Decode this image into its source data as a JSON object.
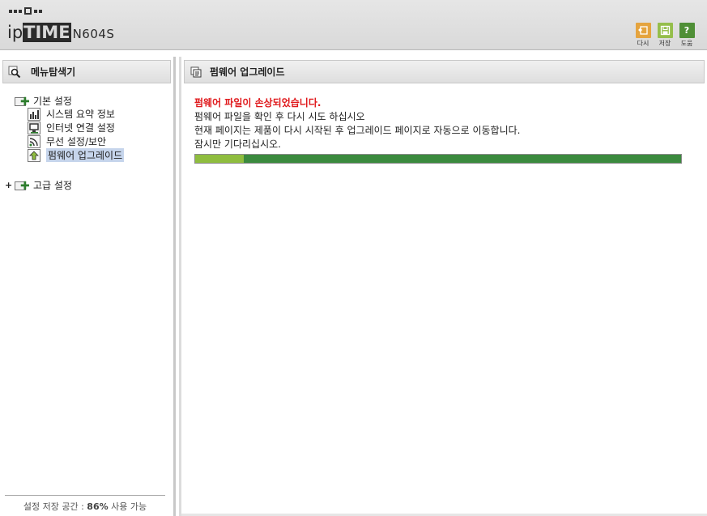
{
  "header": {
    "logo_ip": "ip",
    "logo_time": "TIME",
    "model": "N604S",
    "buttons": {
      "undo_label": "다시",
      "save_label": "저장",
      "help_label": "도움",
      "help_glyph": "?"
    }
  },
  "sidebar": {
    "title": "메뉴탐색기",
    "groups": [
      {
        "label": "기본 설정",
        "expanded": true,
        "items": [
          {
            "label": "시스템 요약 정보",
            "icon": "chart-icon"
          },
          {
            "label": "인터넷 연결 설정",
            "icon": "monitor-icon"
          },
          {
            "label": "무선 설정/보안",
            "icon": "wireless-icon"
          },
          {
            "label": "펌웨어 업그레이드",
            "icon": "upgrade-icon",
            "selected": true
          }
        ]
      },
      {
        "label": "고급 설정",
        "expanded": false,
        "expander": "+"
      }
    ],
    "footer": {
      "prefix": "설정 저장 공간 :",
      "value": "86%",
      "suffix": "사용 가능"
    }
  },
  "main": {
    "title": "펌웨어 업그레이드",
    "error": "펌웨어 파일이 손상되었습니다.",
    "lines": [
      "펌웨어 파일을 확인 후 다시 시도 하십시오",
      "현재 페이지는 제품이 다시 시작된 후 업그레이드 페이지로 자동으로 이동합니다.",
      "잠시만 기다리십시오."
    ],
    "progress": 0.1
  },
  "colors": {
    "error": "#e0191c",
    "progress_light": "#8fbd3f",
    "progress_dark": "#3b8a3e",
    "selected_bg": "#c6d5ec"
  }
}
